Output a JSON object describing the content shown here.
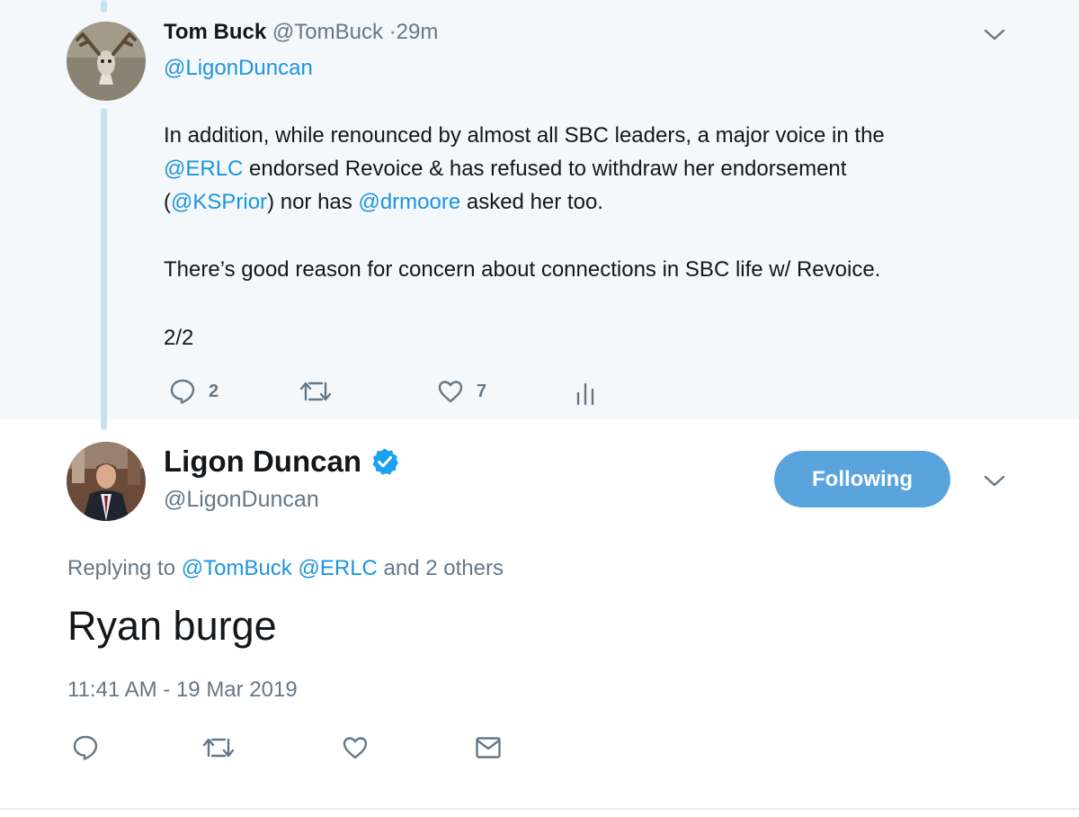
{
  "parent_tweet": {
    "name": "Tom Buck",
    "handle": "@TomBuck",
    "separator": "·",
    "time": "29m",
    "reply_to": "@LigonDuncan",
    "line1": "In addition, while renounced by almost all SBC leaders, a major voice in the",
    "line2_mention": "@ERLC",
    "line2_rest": " endorsed Revoice & has refused to withdraw her endorsement",
    "line3_open": "(",
    "line3_mention1": "@KSPrior",
    "line3_mid": ") nor has ",
    "line3_mention2": "@drmoore",
    "line3_rest": " asked her too.",
    "paragraph2": "There’s good reason for concern about connections in SBC life w/ Revoice.",
    "paragraph3": "2/2",
    "replies_count": "2",
    "likes_count": "7",
    "avatar_icon": "elk-mount-avatar"
  },
  "main_tweet": {
    "name": "Ligon Duncan",
    "handle": "@LigonDuncan",
    "verified_icon": "verified-badge-icon",
    "follow_button": "Following",
    "replying_prefix": "Replying to ",
    "replying_mention1": "@TomBuck",
    "replying_mention2": "@ERLC",
    "replying_suffix": " and 2 others",
    "text": "Ryan burge",
    "timestamp": "11:41 AM - 19 Mar 2019",
    "avatar_icon": "portrait-avatar"
  },
  "colors": {
    "link": "#1b95e0",
    "muted": "#657786",
    "follow_button": "#5aa4de",
    "thread_line": "#c7e2ee",
    "parent_bg": "#f5f8fa"
  }
}
